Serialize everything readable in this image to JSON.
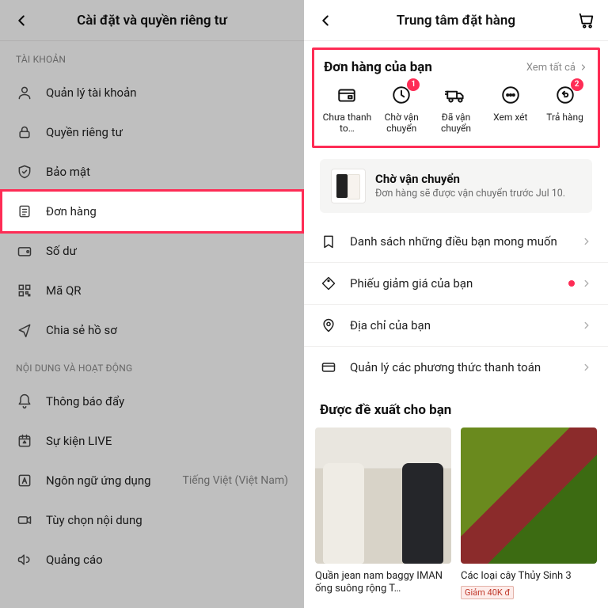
{
  "left": {
    "header_title": "Cài đặt và quyền riêng tư",
    "sections": {
      "account_label": "TÀI KHOẢN",
      "content_label": "NỘI DUNG VÀ HOẠT ĐỘNG"
    },
    "items": {
      "manage_account": "Quản lý tài khoản",
      "privacy": "Quyền riêng tư",
      "security": "Bảo mật",
      "orders": "Đơn hàng",
      "balance": "Số dư",
      "qr_code": "Mã QR",
      "share_profile": "Chia sẻ hồ sơ",
      "push_notifications": "Thông báo đẩy",
      "live_events": "Sự kiện LIVE",
      "app_language": "Ngôn ngữ ứng dụng",
      "app_language_value": "Tiếng Việt (Việt Nam)",
      "content_prefs": "Tùy chọn nội dung",
      "ads": "Quảng cáo"
    }
  },
  "right": {
    "header_title": "Trung tâm đặt hàng",
    "orders_card": {
      "title": "Đơn hàng của bạn",
      "view_all": "Xem tất cả",
      "statuses": [
        {
          "key": "pending",
          "label": "Chưa thanh to…",
          "badge": null
        },
        {
          "key": "awaiting",
          "label": "Chờ vận chuyển",
          "badge": "1"
        },
        {
          "key": "shipped",
          "label": "Đã vận chuyển",
          "badge": null
        },
        {
          "key": "review",
          "label": "Xem xét",
          "badge": null
        },
        {
          "key": "returns",
          "label": "Trả hàng",
          "badge": "2"
        }
      ]
    },
    "ship_card": {
      "title": "Chờ vận chuyển",
      "subtitle": "Đơn hàng sẽ được vận chuyển trước Jul 10."
    },
    "links": {
      "wishlist": "Danh sách những điều bạn mong muốn",
      "coupons": "Phiếu giảm giá của bạn",
      "address": "Địa chỉ của bạn",
      "payments": "Quản lý các phương thức thanh toán"
    },
    "recommend_title": "Được đề xuất cho bạn",
    "products": [
      {
        "title": "Quần jean nam baggy IMAN ống suông rộng T…",
        "tag": null
      },
      {
        "title": "Các loại cây Thủy Sinh 3",
        "tag": "Giảm 40K đ"
      }
    ]
  }
}
